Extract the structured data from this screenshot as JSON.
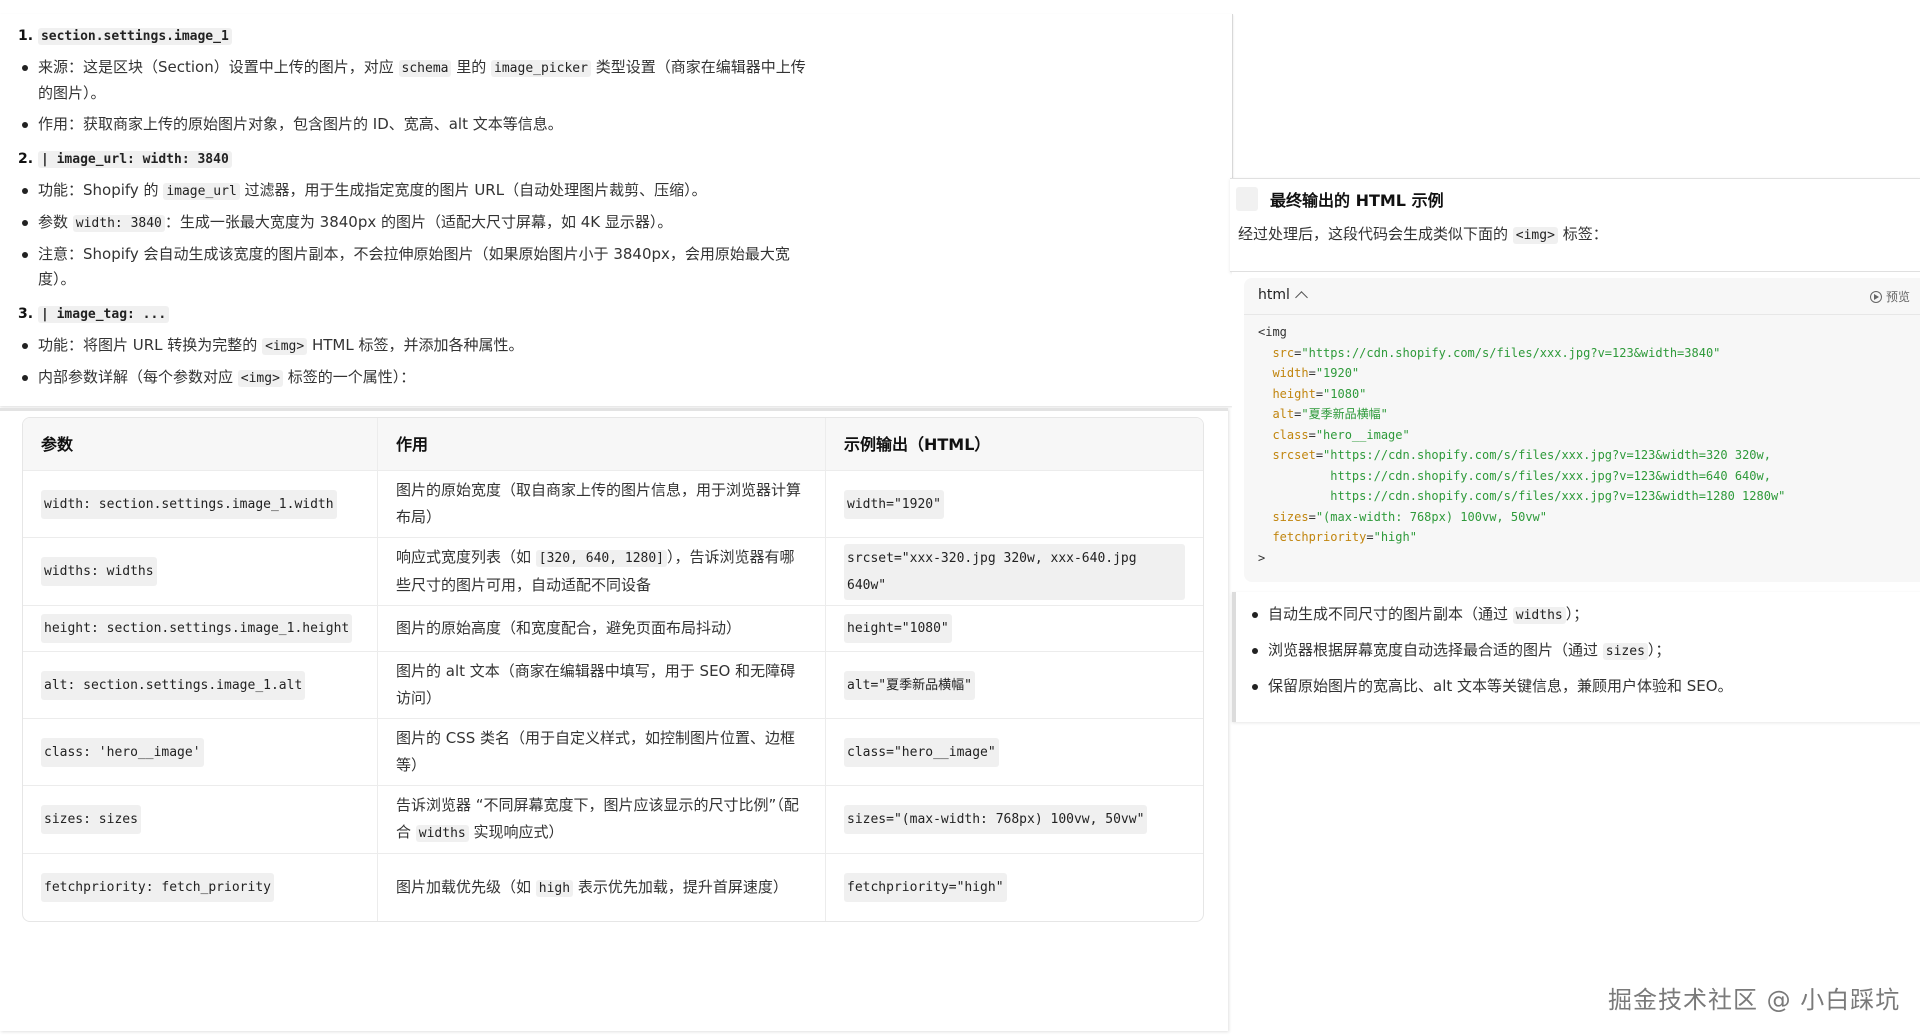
{
  "notes": {
    "item1": {
      "num": "1.",
      "code": "section.settings.image_1",
      "bullets": [
        {
          "pre": "来源：这是区块（Section）设置中上传的图片，对应 ",
          "c1": "schema",
          "mid": " 里的 ",
          "c2": "image_picker",
          "post": " 类型设置（商家在编辑器中上传的图片）。"
        },
        {
          "text": "作用：获取商家上传的原始图片对象，包含图片的 ID、宽高、alt 文本等信息。"
        }
      ]
    },
    "item2": {
      "num": "2.",
      "code": "| image_url: width: 3840",
      "bullets": [
        {
          "pre": "功能：Shopify 的 ",
          "c1": "image_url",
          "post": " 过滤器，用于生成指定宽度的图片 URL（自动处理图片裁剪、压缩）。"
        },
        {
          "pre": "参数 ",
          "c1": "width: 3840",
          "post": "：生成一张最大宽度为 3840px 的图片（适配大尺寸屏幕，如 4K 显示器）。"
        },
        {
          "text": "注意：Shopify 会自动生成该宽度的图片副本，不会拉伸原始图片（如果原始图片小于 3840px，会用原始最大宽度）。"
        }
      ]
    },
    "item3": {
      "num": "3.",
      "code": "| image_tag: ...",
      "bullets": [
        {
          "pre": "功能：将图片 URL 转换为完整的 ",
          "c1": "<img>",
          "post": " HTML 标签，并添加各种属性。"
        },
        {
          "pre": "内部参数详解（每个参数对应 ",
          "c1": "<img>",
          "post": " 标签的一个属性）："
        }
      ]
    }
  },
  "table": {
    "headers": [
      "参数",
      "作用",
      "示例输出（HTML）"
    ],
    "rows": [
      {
        "param": "width: section.settings.image_1.width",
        "effect": "图片的原始宽度（取自商家上传的图片信息，用于浏览器计算布局）",
        "output": "width=\"1920\""
      },
      {
        "param": "widths: widths",
        "effect_pre": "响应式宽度列表（如 ",
        "effect_code": "[320, 640, 1280]",
        "effect_post": "），告诉浏览器有哪些尺寸的图片可用，自动适配不同设备",
        "output": "srcset=\"xxx-320.jpg 320w, xxx-640.jpg 640w\""
      },
      {
        "param": "height: section.settings.image_1.height",
        "effect": "图片的原始高度（和宽度配合，避免页面布局抖动）",
        "output": "height=\"1080\""
      },
      {
        "param": "alt: section.settings.image_1.alt",
        "effect": "图片的 alt 文本（商家在编辑器中填写，用于 SEO 和无障碍访问）",
        "output": "alt=\"夏季新品横幅\""
      },
      {
        "param": "class: 'hero__image'",
        "effect": "图片的 CSS 类名（用于自定义样式，如控制图片位置、边框等）",
        "output": "class=\"hero__image\""
      },
      {
        "param": "sizes: sizes",
        "effect_pre": "告诉浏览器 “不同屏幕宽度下，图片应该显示的尺寸比例”（配合 ",
        "effect_code": "widths",
        "effect_post": " 实现响应式）",
        "output": "sizes=\"(max-width: 768px) 100vw, 50vw\""
      },
      {
        "param": "fetchpriority: fetch_priority",
        "effect_pre": "图片加载优先级（如 ",
        "effect_code": "high",
        "effect_post": " 表示优先加载，提升首屏速度）",
        "output": "fetchpriority=\"high\""
      }
    ]
  },
  "final": {
    "heading": "最终输出的 HTML 示例",
    "desc_pre": "经过处理后，这段代码会生成类似下面的 ",
    "desc_code": "<img>",
    "desc_post": " 标签："
  },
  "code": {
    "lang": "html",
    "preview": "预览",
    "open": "<img",
    "attrs": [
      {
        "name": "src",
        "value": "\"https://cdn.shopify.com/s/files/xxx.jpg?v=123&width=3840\""
      },
      {
        "name": "width",
        "value": "\"1920\""
      },
      {
        "name": "height",
        "value": "\"1080\""
      },
      {
        "name": "alt",
        "value": "\"夏季新品横幅\""
      },
      {
        "name": "class",
        "value": "\"hero__image\""
      },
      {
        "name": "srcset",
        "value": "\"https://cdn.shopify.com/s/files/xxx.jpg?v=123&width=320 320w,"
      },
      {
        "name": "",
        "value": "https://cdn.shopify.com/s/files/xxx.jpg?v=123&width=640 640w,"
      },
      {
        "name": "",
        "value": "https://cdn.shopify.com/s/files/xxx.jpg?v=123&width=1280 1280w\""
      },
      {
        "name": "sizes",
        "value": "\"(max-width: 768px) 100vw, 50vw\""
      },
      {
        "name": "fetchpriority",
        "value": "\"high\""
      }
    ],
    "close": ">"
  },
  "summary": [
    {
      "pre": "自动生成不同尺寸的图片副本（通过 ",
      "c1": "widths",
      "post": "）；"
    },
    {
      "pre": "浏览器根据屏幕宽度自动选择最合适的图片（通过 ",
      "c1": "sizes",
      "post": "）；"
    },
    {
      "text": "保留原始图片的宽高比、alt 文本等关键信息，兼顾用户体验和 SEO。"
    }
  ],
  "watermark": "掘金技术社区 @ 小白踩坑"
}
